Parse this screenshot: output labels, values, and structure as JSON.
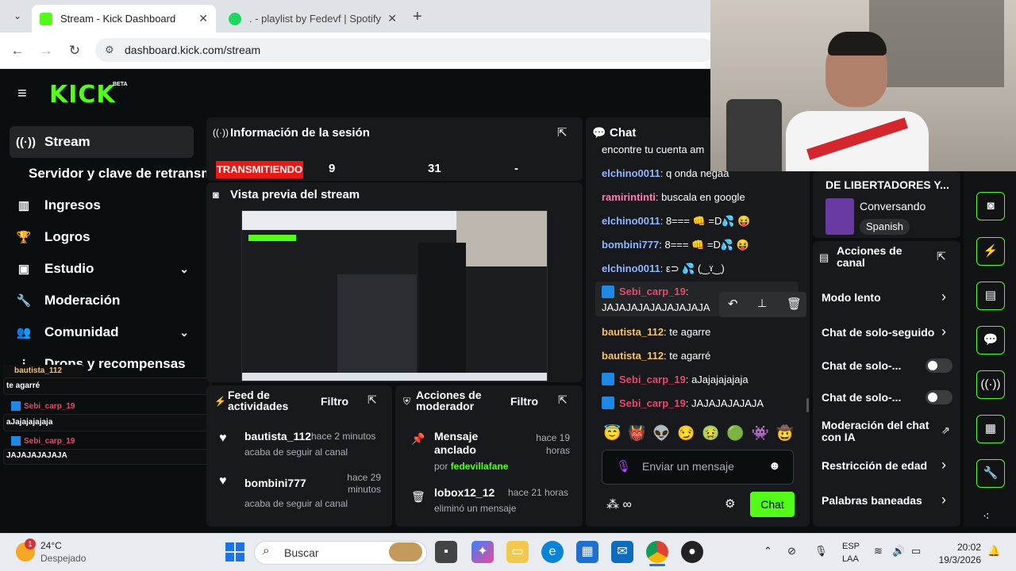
{
  "browser": {
    "tabs": [
      {
        "title": "Stream - Kick Dashboard",
        "active": true
      },
      {
        "title": ". - playlist by Fedevf | Spotify",
        "active": false
      }
    ],
    "url": "dashboard.kick.com/stream"
  },
  "app": {
    "logo": "KICK",
    "logo_badge": "BETA",
    "sidebar": [
      {
        "label": "Stream",
        "icon": "broadcast-icon"
      },
      {
        "label": "Servidor y clave de retransm",
        "icon": ""
      },
      {
        "label": "Ingresos",
        "icon": "bar-chart-icon"
      },
      {
        "label": "Logros",
        "icon": "trophy-icon"
      },
      {
        "label": "Estudio",
        "icon": "studio-icon"
      },
      {
        "label": "Moderación",
        "icon": "wrench-icon"
      },
      {
        "label": "Comunidad",
        "icon": "users-icon"
      },
      {
        "label": "Drops y recompensas",
        "icon": "drops-icon"
      }
    ],
    "overlay_chat": [
      {
        "user": "bautista_112",
        "text": "te agarré"
      },
      {
        "user": "Sebi_carp_19",
        "text": "aJajajajajaja"
      },
      {
        "user": "Sebi_carp_19",
        "text": "JAJAJAJAJAJA"
      }
    ],
    "session": {
      "title": "Información de la sesión",
      "status": "TRANSMITIENDO",
      "stat1": "9",
      "stat2": "31",
      "stat3": "-"
    },
    "preview": {
      "title": "Vista previa del stream"
    },
    "activity": {
      "title": "Feed de actividades",
      "filter": "Filtro",
      "items": [
        {
          "user": "bautista_112",
          "time": "hace 2 minutos",
          "action": "acaba de seguir al canal"
        },
        {
          "user": "bombini777",
          "time": "hace 29 minutos",
          "action": "acaba de seguir al canal"
        }
      ]
    },
    "mod_actions": {
      "title": "Acciones de moderador",
      "filter": "Filtro",
      "items": [
        {
          "title": "Mensaje anclado",
          "by_prefix": "por",
          "by": "fedevillafane",
          "time": "hace 19 horas"
        },
        {
          "title": "lobox12_12",
          "detail": "eliminó un mensaje",
          "time": "hace 21 horas"
        }
      ]
    },
    "chat": {
      "title": "Chat",
      "messages": [
        {
          "user": "",
          "text": "encontre tu cuenta am"
        },
        {
          "user": "elchino0011",
          "text": "q onda negaa"
        },
        {
          "user": "ramirintinti",
          "text": "buscala en google"
        },
        {
          "user": "elchino0011",
          "text": "8=== 👊 =D💦 😝"
        },
        {
          "user": "bombini777",
          "text": "8=== 👊 =D💦 😝"
        },
        {
          "user": "elchino0011",
          "text": "ε⊃ 💦 (‿ˠ‿)"
        },
        {
          "user": "Sebi_carp_19",
          "text": "JAJAJAJAJAJAJAJAJA"
        },
        {
          "user": "bautista_112",
          "text": "te agarre"
        },
        {
          "user": "bautista_112",
          "text": "te agarré"
        },
        {
          "user": "Sebi_carp_19",
          "text": "aJajajajajaja"
        },
        {
          "user": "Sebi_carp_19",
          "text": "JAJAJAJAJAJA"
        }
      ],
      "emotes": [
        "😇",
        "👹",
        "👽",
        "😏",
        "🤢",
        "🟢",
        "👾",
        "🤠"
      ],
      "input_placeholder": "Enviar un mensaje",
      "send_label": "Chat"
    },
    "channel": {
      "title_fragment": "DE LIBERTADORES Y...",
      "category": "Conversando",
      "language": "Spanish",
      "actions_title": "Acciones de canal",
      "actions": [
        {
          "label": "Modo lento",
          "control": "arrow"
        },
        {
          "label": "Chat de solo-seguido",
          "control": "arrow"
        },
        {
          "label": "Chat de solo-...",
          "control": "toggle"
        },
        {
          "label": "Chat de solo-...",
          "control": "toggle"
        },
        {
          "label": "Moderación del chat con IA",
          "control": "external"
        },
        {
          "label": "Restricción de edad",
          "control": "arrow"
        },
        {
          "label": "Palabras baneadas",
          "control": "arrow"
        }
      ]
    }
  },
  "taskbar": {
    "weather_temp": "24°C",
    "weather_text": "Despejado",
    "weather_badge": "1",
    "search_placeholder": "Buscar",
    "lang": "ESP",
    "lang_sub": "LAA",
    "time": "20:02",
    "date": "19/3/2026"
  },
  "colors": {
    "kick_green": "#53fc18",
    "bg": "#0b0e0f",
    "panel": "#18191c",
    "live_red": "#e91916"
  }
}
